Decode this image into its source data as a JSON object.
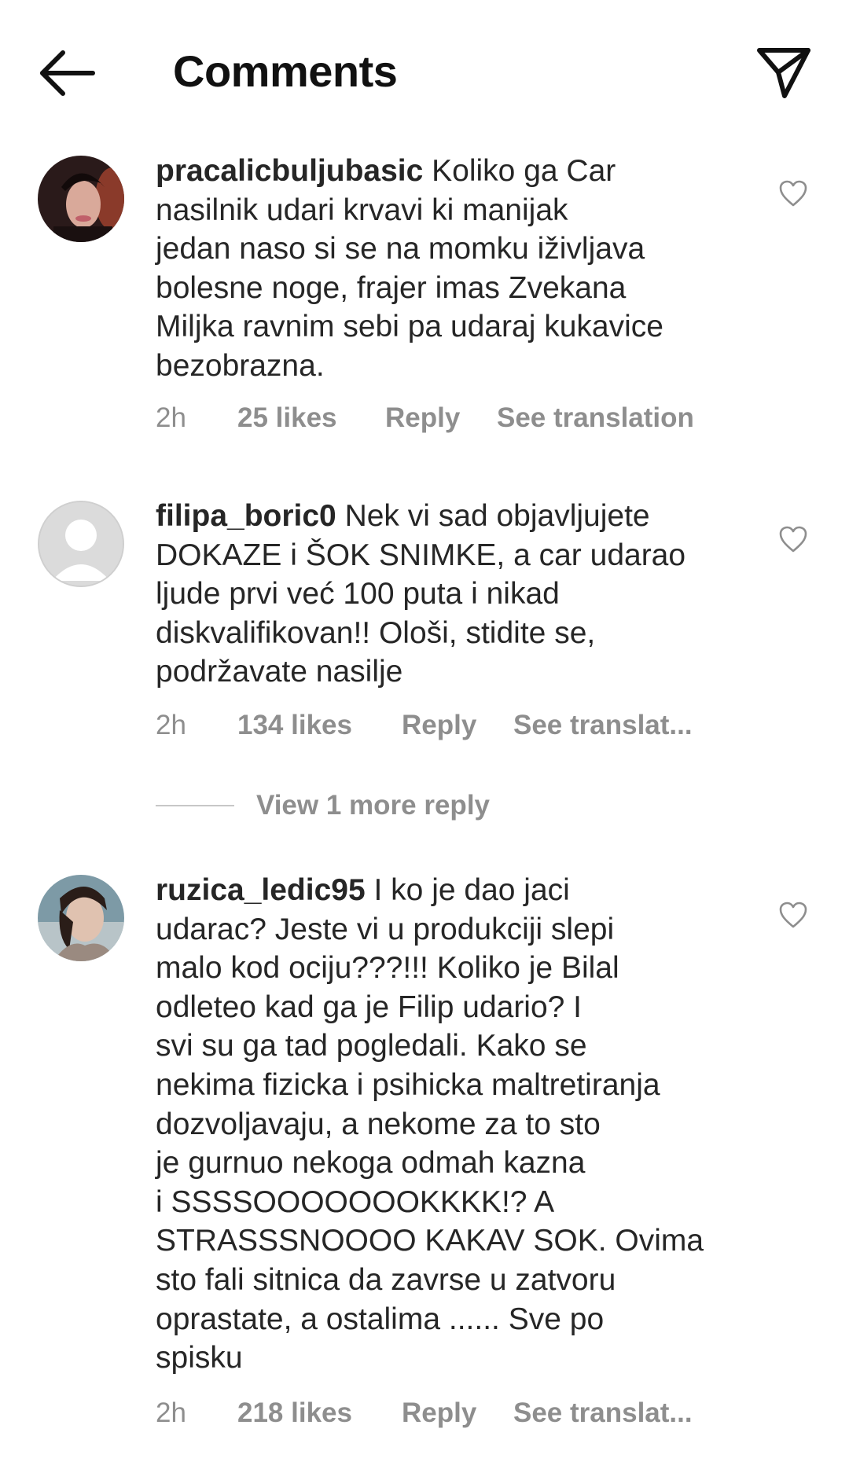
{
  "header": {
    "title": "Comments",
    "back_icon": "arrow-left-icon",
    "share_icon": "send-icon"
  },
  "comments": [
    {
      "username": "pracalicbuljubasic",
      "text": " Koliko ga Car\nnasilnik udari krvavi ki manijak\njedan naso si se na momku iživljava\nbolesne noge, frajer imas Zvekana\nMiljka ravnim sebi pa udaraj kukavice\nbezobrazna.",
      "time": "2h",
      "likes": "25 likes",
      "reply": "Reply",
      "translation": "See translation"
    },
    {
      "username": "filipa_boric0",
      "text": " Nek vi sad objavljujete\nDOKAZE i ŠOK SNIMKE, a car udarao\nljude prvi već 100 puta i nikad\ndiskvalifikovan!! Ološi, stidite se,\npodržavate nasilje",
      "time": "2h",
      "likes": "134 likes",
      "reply": "Reply",
      "translation": "See translat..."
    },
    {
      "username": "ruzica_ledic95",
      "text": " I ko je dao jaci\nudarac? Jeste vi u produkciji slepi\nmalo kod ociju???!!! Koliko je Bilal\nodleteo kad ga je Filip udario? I\nsvi su ga tad pogledali. Kako se\nnekima fizicka i psihicka maltretiranja\ndozvoljavaju, a nekome za to sto\nje gurnuo nekoga odmah kazna\ni SSSSOOOOOOOKKKK!? A\nSTRASSSNOOOO KAKAV SOK. Ovima\nsto fali sitnica da zavrse u zatvoru\noprastate, a ostalima ...... Sve po\nspisku",
      "time": "2h",
      "likes": "218 likes",
      "reply": "Reply",
      "translation": "See translat..."
    }
  ],
  "view_more_replies": "View 1 more reply",
  "colors": {
    "text": "#262626",
    "secondary": "#8e8e8e",
    "background": "#ffffff"
  }
}
